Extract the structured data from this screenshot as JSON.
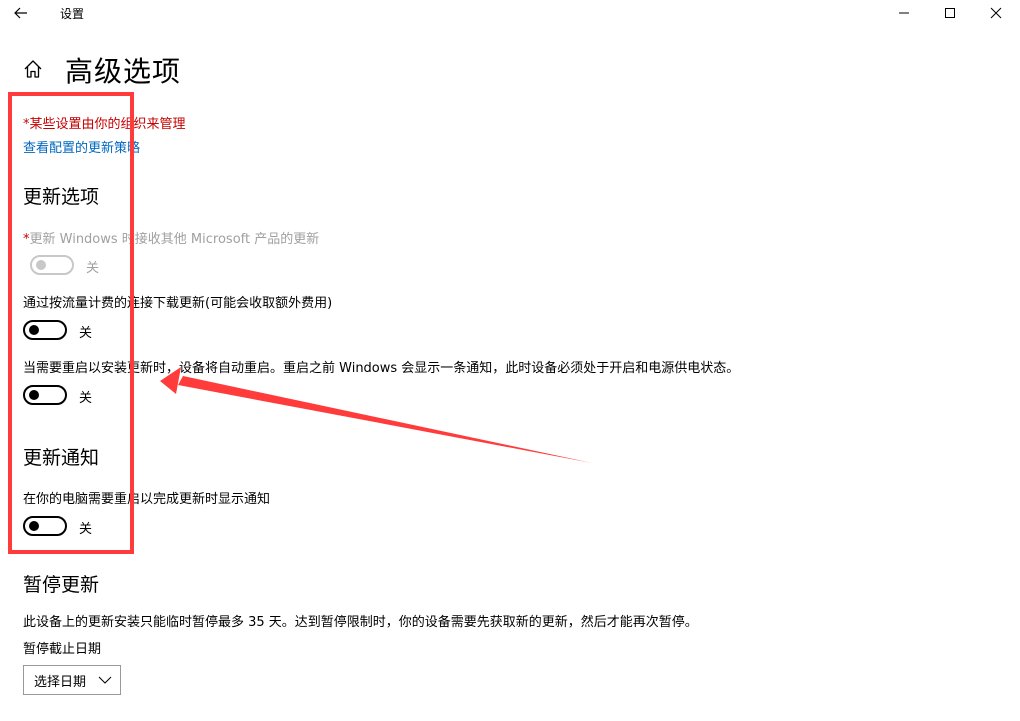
{
  "window": {
    "title": "设置",
    "back_icon": "back-arrow-icon",
    "minimize_icon": "minimize-icon",
    "maximize_icon": "maximize-icon",
    "close_icon": "close-icon"
  },
  "page": {
    "home_icon": "home-icon",
    "title": "高级选项",
    "managed_notice": "*某些设置由你的组织来管理",
    "policy_link": "查看配置的更新策略"
  },
  "update_options": {
    "title": "更新选项",
    "items": [
      {
        "star": "*",
        "label": "更新 Windows 时接收其他 Microsoft 产品的更新",
        "state": "关",
        "disabled": true
      },
      {
        "label": "通过按流量计费的连接下载更新(可能会收取额外费用)",
        "state": "关",
        "disabled": false
      },
      {
        "label": "当需要重启以安装更新时，设备将自动重启。重启之前 Windows 会显示一条通知，此时设备必须处于开启和电源供电状态。",
        "state": "关",
        "disabled": false
      }
    ]
  },
  "update_notifications": {
    "title": "更新通知",
    "items": [
      {
        "label": "在你的电脑需要重启以完成更新时显示通知",
        "state": "关"
      }
    ]
  },
  "pause_updates": {
    "title": "暂停更新",
    "description": "此设备上的更新安装只能临时暂停最多 35 天。达到暂停限制时，你的设备需要先获取新的更新，然后才能再次暂停。",
    "date_label": "暂停截止日期",
    "select_value": "选择日期",
    "select_icon": "chevron-down-icon"
  },
  "annotations": {
    "highlight_color": "#ff3b3b"
  }
}
